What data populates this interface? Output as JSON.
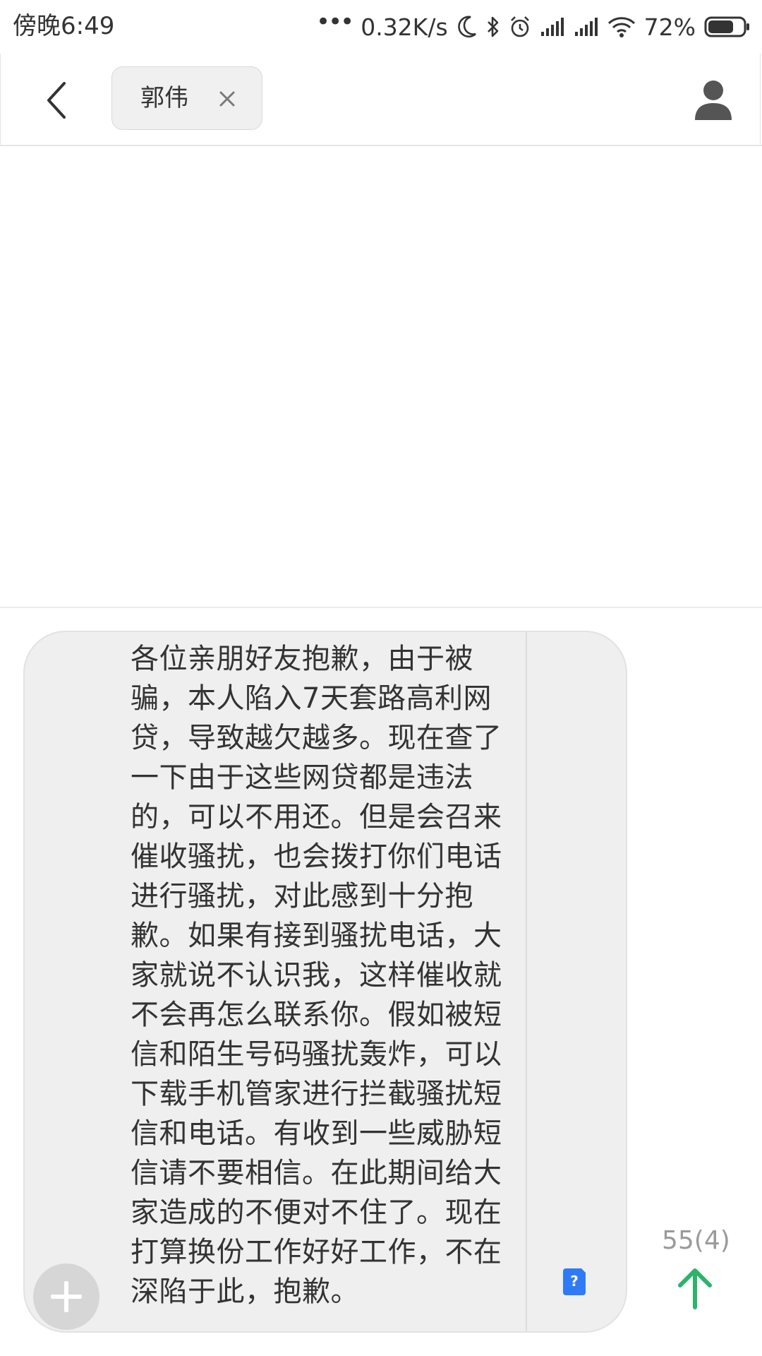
{
  "status_bar": {
    "time": "傍晚6:49",
    "dots": "•••",
    "network_speed": "0.32K/s",
    "battery_percent": "72%",
    "icons": [
      "moon-icon",
      "bluetooth-icon",
      "alarm-icon",
      "signal-icon",
      "signal-icon",
      "wifi-icon",
      "battery-icon"
    ],
    "battery_level": 0.72
  },
  "header": {
    "back_icon": "chevron-left-icon",
    "recipient": "郭伟",
    "remove_icon": "close-icon",
    "contact_icon": "person-icon"
  },
  "composer": {
    "message_text": "各位亲朋好友抱歉，由于被\n骗，本人陷入7天套路高利网\n贷，导致越欠越多。现在查了\n一下由于这些网贷都是违法\n的，可以不用还。但是会召来\n催收骚扰，也会拨打你们电话\n进行骚扰，对此感到十分抱\n歉。如果有接到骚扰电话，大\n家就说不认识我，这样催收就\n不会再怎么联系你。假如被短\n信和陌生号码骚扰轰炸，可以\n下载手机管家进行拦截骚扰短\n信和电话。有收到一些威胁短\n信请不要相信。在此期间给大\n家造成的不便对不住了。现在\n打算换份工作好好工作，不在\n深陷于此，抱歉。",
    "char_count": "55(4)",
    "sim_label": "?",
    "attach_icon": "plus-icon",
    "send_icon": "arrow-up-icon",
    "send_color": "#2db36b",
    "sim_color": "#2f7bf5"
  }
}
